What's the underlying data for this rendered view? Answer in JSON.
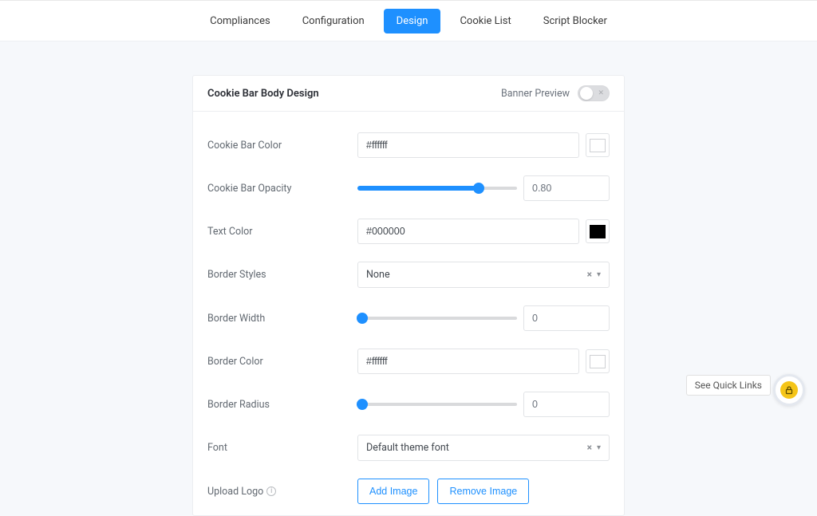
{
  "nav": {
    "items": [
      {
        "label": "Compliances",
        "active": false
      },
      {
        "label": "Configuration",
        "active": false
      },
      {
        "label": "Design",
        "active": true
      },
      {
        "label": "Cookie List",
        "active": false
      },
      {
        "label": "Script Blocker",
        "active": false
      }
    ]
  },
  "header": {
    "title": "Cookie Bar Body Design",
    "banner_preview_label": "Banner Preview",
    "banner_preview_on": false
  },
  "fields": {
    "cookie_bar_color": {
      "label": "Cookie Bar Color",
      "value": "#ffffff",
      "swatch": "#ffffff"
    },
    "cookie_bar_opacity": {
      "label": "Cookie Bar Opacity",
      "value": "0.80",
      "percent": 76
    },
    "text_color": {
      "label": "Text Color",
      "value": "#000000",
      "swatch": "#000000"
    },
    "border_styles": {
      "label": "Border Styles",
      "value": "None"
    },
    "border_width": {
      "label": "Border Width",
      "value": "0",
      "percent": 0
    },
    "border_color": {
      "label": "Border Color",
      "value": "#ffffff",
      "swatch": "#ffffff"
    },
    "border_radius": {
      "label": "Border Radius",
      "value": "0",
      "percent": 0
    },
    "font": {
      "label": "Font",
      "value": "Default theme font"
    },
    "upload_logo": {
      "label": "Upload Logo"
    }
  },
  "buttons": {
    "add_image": "Add Image",
    "remove_image": "Remove Image"
  },
  "quicklinks": {
    "label": "See Quick Links"
  }
}
